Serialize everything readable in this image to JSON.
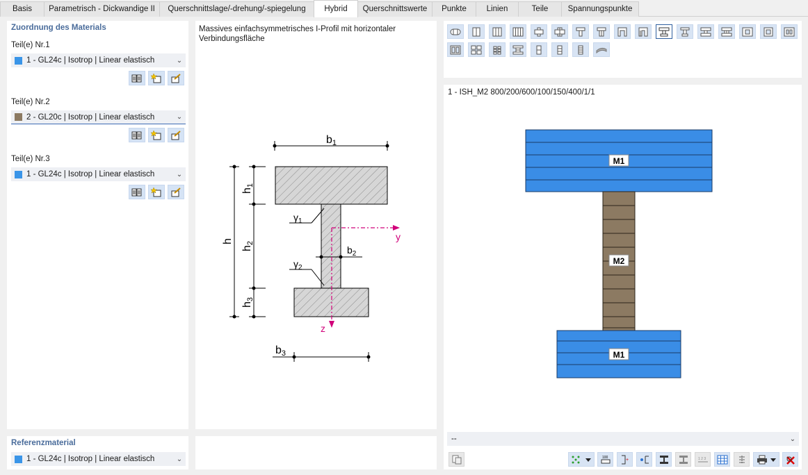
{
  "tabs": [
    {
      "label": "Basis",
      "active": false
    },
    {
      "label": "Parametrisch - Dickwandige II",
      "active": false
    },
    {
      "label": "Querschnittslage/-drehung/-spiegelung",
      "active": false
    },
    {
      "label": "Hybrid",
      "active": true
    },
    {
      "label": "Querschnittswerte",
      "active": false
    },
    {
      "label": "Punkte",
      "active": false
    },
    {
      "label": "Linien",
      "active": false
    },
    {
      "label": "Teile",
      "active": false
    },
    {
      "label": "Spannungspunkte",
      "active": false
    }
  ],
  "material_assignment": {
    "title": "Zuordnung des Materials",
    "parts": [
      {
        "label": "Teil(e) Nr.1",
        "material": "1 - GL24c | Isotrop | Linear elastisch",
        "color": "#3a95e8"
      },
      {
        "label": "Teil(e) Nr.2",
        "material": "2 - GL20c | Isotrop | Linear elastisch",
        "color": "#8c7a62"
      },
      {
        "label": "Teil(e) Nr.3",
        "material": "1 - GL24c | Isotrop | Linear elastisch",
        "color": "#3a95e8"
      }
    ],
    "buttons": [
      "library-icon",
      "new-material-icon",
      "edit-material-icon"
    ]
  },
  "reference_material": {
    "title": "Referenzmaterial",
    "material": "1 - GL24c | Isotrop | Linear elastisch",
    "color": "#3a95e8"
  },
  "description": "Massives einfachsymmetrisches I-Profil mit horizontaler Verbindungsfläche",
  "diagram": {
    "b1": "b",
    "b1_sub": "1",
    "b2": "b",
    "b2_sub": "2",
    "b3": "b",
    "b3_sub": "3",
    "h": "h",
    "h1": "h",
    "h1_sub": "1",
    "h2": "h",
    "h2_sub": "2",
    "h3": "h",
    "h3_sub": "3",
    "g1": "γ",
    "g1_sub": "1",
    "g2": "γ",
    "g2_sub": "2",
    "y": "y",
    "z": "z"
  },
  "preview": {
    "title": "1 - ISH_M2 800/200/600/100/150/400/1/1",
    "labels": {
      "top": "M1",
      "web": "M2",
      "bottom": "M1"
    },
    "colors": {
      "flange": "#3a8de6",
      "web": "#8c7a62"
    }
  },
  "bottom_combo": "--",
  "toolbar_icons": [
    "points-icon",
    "dimension-icon",
    "stress-point-icon",
    "axes-icon",
    "section-icon",
    "section-alt-icon",
    "numbering-icon",
    "grid-icon",
    "list-icon",
    "print-icon",
    "delete-icon"
  ]
}
